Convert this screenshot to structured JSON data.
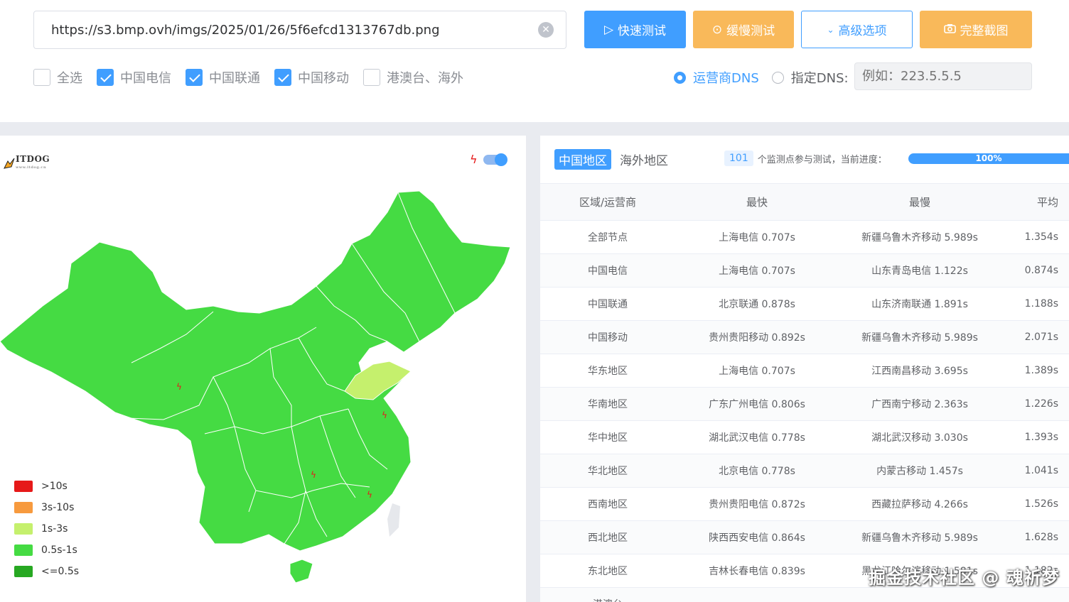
{
  "url_input": {
    "value": "https://s3.bmp.ovh/imgs/2025/01/26/5f6efcd1313767db.png"
  },
  "buttons": {
    "fast": "快速测试",
    "slow": "缓慢测试",
    "advanced": "高级选项",
    "screenshot": "完整截图"
  },
  "isp_checks": [
    {
      "label": "全选",
      "checked": false
    },
    {
      "label": "中国电信",
      "checked": true
    },
    {
      "label": "中国联通",
      "checked": true
    },
    {
      "label": "中国移动",
      "checked": true
    },
    {
      "label": "港澳台、海外",
      "checked": false
    }
  ],
  "dns": {
    "option_isp": "运营商DNS",
    "option_custom": "指定DNS:",
    "selected": "运营商DNS",
    "placeholder": "例如：223.5.5.5"
  },
  "map": {
    "logo_text": "ITDOG",
    "logo_sub": "www.itdog.cn",
    "toggle_on": true,
    "legend": [
      {
        "label": ">10s",
        "color": "#e61919"
      },
      {
        "label": "3s-10s",
        "color": "#f79a3e"
      },
      {
        "label": "1s-3s",
        "color": "#c5f06d"
      },
      {
        "label": "0.5s-1s",
        "color": "#45db43"
      },
      {
        "label": "<=0.5s",
        "color": "#27a822"
      }
    ],
    "colors": {
      "region": "#45db43",
      "highlight": "#c5f06d",
      "marker": "#e61919"
    }
  },
  "results": {
    "tabs": [
      "中国地区",
      "海外地区"
    ],
    "active_tab": "中国地区",
    "node_count": "101",
    "progress_text": "个监测点参与测试，当前进度：",
    "progress_percent": "100%",
    "progress_value": 1.0,
    "columns": [
      "区域/运营商",
      "最快",
      "最慢",
      "平均"
    ],
    "rows": [
      {
        "region": "全部节点",
        "fastest": "上海电信 0.707s",
        "slowest": "新疆乌鲁木齐移动 5.989s",
        "avg": "1.354s"
      },
      {
        "region": "中国电信",
        "fastest": "上海电信 0.707s",
        "slowest": "山东青岛电信 1.122s",
        "avg": "0.874s"
      },
      {
        "region": "中国联通",
        "fastest": "北京联通 0.878s",
        "slowest": "山东济南联通 1.891s",
        "avg": "1.188s"
      },
      {
        "region": "中国移动",
        "fastest": "贵州贵阳移动 0.892s",
        "slowest": "新疆乌鲁木齐移动 5.989s",
        "avg": "2.071s"
      },
      {
        "region": "华东地区",
        "fastest": "上海电信 0.707s",
        "slowest": "江西南昌移动 3.695s",
        "avg": "1.389s"
      },
      {
        "region": "华南地区",
        "fastest": "广东广州电信 0.806s",
        "slowest": "广西南宁移动 2.363s",
        "avg": "1.226s"
      },
      {
        "region": "华中地区",
        "fastest": "湖北武汉电信 0.778s",
        "slowest": "湖北武汉移动 3.030s",
        "avg": "1.393s"
      },
      {
        "region": "华北地区",
        "fastest": "北京电信 0.778s",
        "slowest": "内蒙古移动 1.457s",
        "avg": "1.041s"
      },
      {
        "region": "西南地区",
        "fastest": "贵州贵阳电信 0.872s",
        "slowest": "西藏拉萨移动 4.266s",
        "avg": "1.526s"
      },
      {
        "region": "西北地区",
        "fastest": "陕西西安电信 0.864s",
        "slowest": "新疆乌鲁木齐移动 5.989s",
        "avg": "1.628s"
      },
      {
        "region": "东北地区",
        "fastest": "吉林长春电信 0.839s",
        "slowest": "黑龙江哈尔滨移动 1.581s",
        "avg": "1.182s"
      },
      {
        "region": "港澳台",
        "fastest": "",
        "slowest": "",
        "avg": ""
      }
    ]
  },
  "watermark": "掘金技术社区 @ 魂祈梦"
}
